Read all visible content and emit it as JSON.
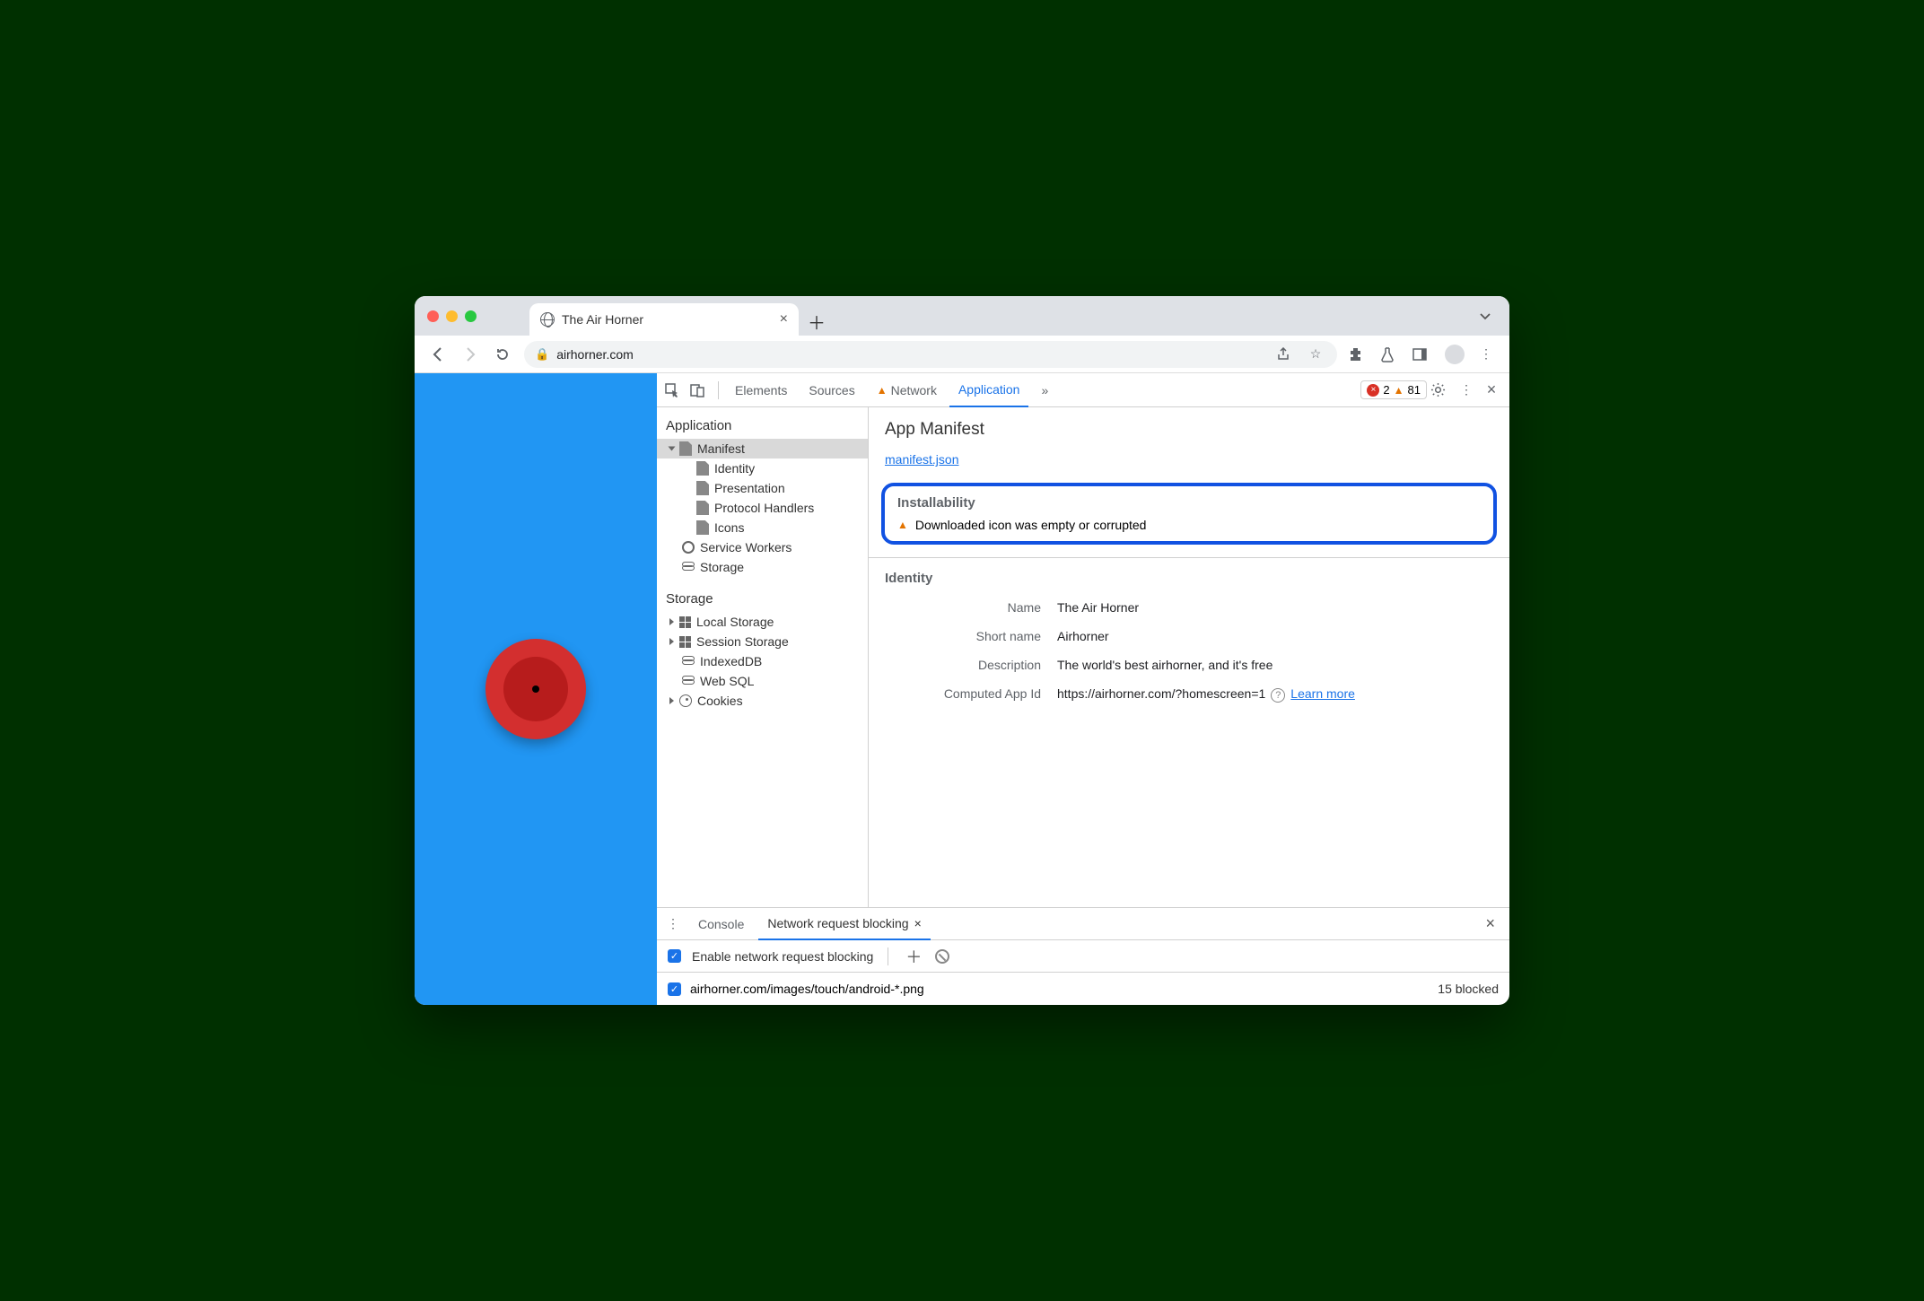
{
  "tab": {
    "title": "The Air Horner"
  },
  "url": "airhorner.com",
  "devtools": {
    "tabs": {
      "elements": "Elements",
      "sources": "Sources",
      "network": "Network",
      "application": "Application"
    },
    "errors": 2,
    "warnings": 81
  },
  "sidebar": {
    "app_heading": "Application",
    "manifest": "Manifest",
    "identity": "Identity",
    "presentation": "Presentation",
    "protocol": "Protocol Handlers",
    "icons": "Icons",
    "service_workers": "Service Workers",
    "storage": "Storage",
    "storage_heading": "Storage",
    "local": "Local Storage",
    "session": "Session Storage",
    "indexed": "IndexedDB",
    "websql": "Web SQL",
    "cookies": "Cookies"
  },
  "manifest": {
    "heading": "App Manifest",
    "link": "manifest.json",
    "install_h": "Installability",
    "install_msg": "Downloaded icon was empty or corrupted",
    "identity_h": "Identity",
    "fields": {
      "name_l": "Name",
      "name_v": "The Air Horner",
      "short_l": "Short name",
      "short_v": "Airhorner",
      "desc_l": "Description",
      "desc_v": "The world's best airhorner, and it's free",
      "appid_l": "Computed App Id",
      "appid_v": "https://airhorner.com/?homescreen=1",
      "learn": "Learn more"
    }
  },
  "drawer": {
    "console": "Console",
    "nrb": "Network request blocking",
    "enable": "Enable network request blocking",
    "pattern": "airhorner.com/images/touch/android-*.png",
    "blocked": "15 blocked"
  }
}
